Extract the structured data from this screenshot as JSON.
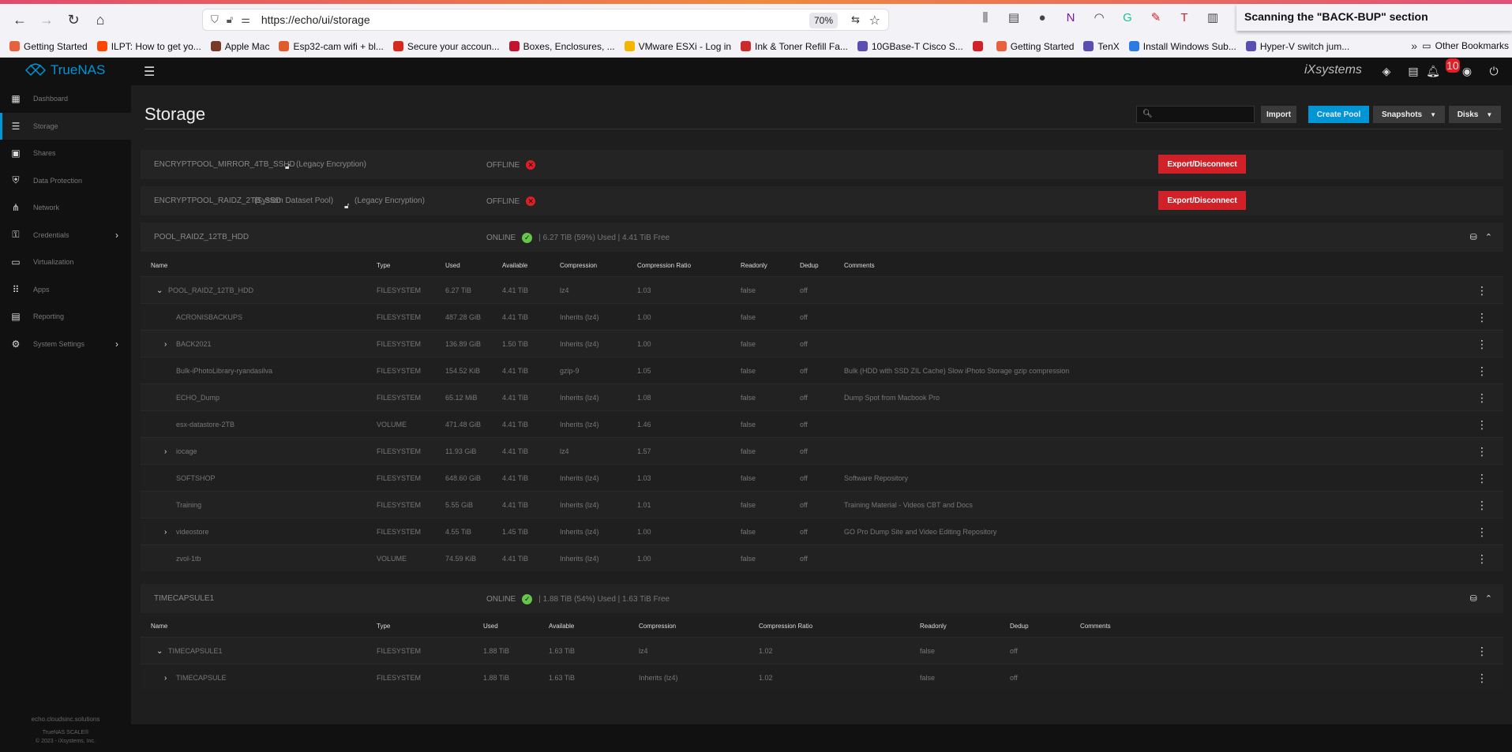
{
  "browser": {
    "url": "https://echo/ui/storage",
    "zoom": "70%",
    "notification": "Scanning the \"BACK-BUP\" section",
    "bookmarks": [
      {
        "label": "Getting Started",
        "color": "#e8603c"
      },
      {
        "label": "ILPT: How to get yo...",
        "color": "#ff4500"
      },
      {
        "label": "Apple Mac",
        "color": "#7a3a2a"
      },
      {
        "label": "Esp32-cam wifi + bl...",
        "color": "#e05a2a"
      },
      {
        "label": "Secure your accoun...",
        "color": "#d52b1e"
      },
      {
        "label": "Boxes, Enclosures, ...",
        "color": "#c41230"
      },
      {
        "label": "VMware ESXi - Log in",
        "color": "#f5b400"
      },
      {
        "label": "Ink & Toner Refill Fa...",
        "color": "#cc2b2b"
      },
      {
        "label": "10GBase-T Cisco S...",
        "color": "#5a4fb0"
      },
      {
        "label": "",
        "color": "#d12027"
      },
      {
        "label": "Getting Started",
        "color": "#e8603c"
      },
      {
        "label": "TenX",
        "color": "#5a4fb0"
      },
      {
        "label": "Install Windows Sub...",
        "color": "#2a7be4"
      },
      {
        "label": "Hyper-V switch jum...",
        "color": "#5a4fb0"
      }
    ],
    "other_bookmarks": "Other Bookmarks"
  },
  "app": {
    "brand": "TrueNAS",
    "vendor": "iXsystems",
    "notification_count": "10",
    "sidebar": {
      "items": [
        {
          "label": "Dashboard",
          "icon": "dashboard-icon",
          "glyph": "▦"
        },
        {
          "label": "Storage",
          "icon": "storage-icon",
          "glyph": "☰"
        },
        {
          "label": "Shares",
          "icon": "shares-icon",
          "glyph": "▣"
        },
        {
          "label": "Data Protection",
          "icon": "shield-icon",
          "glyph": "⛨"
        },
        {
          "label": "Network",
          "icon": "network-icon",
          "glyph": "⋔"
        },
        {
          "label": "Credentials",
          "icon": "key-icon",
          "glyph": "⚿"
        },
        {
          "label": "Virtualization",
          "icon": "monitor-icon",
          "glyph": "▭"
        },
        {
          "label": "Apps",
          "icon": "apps-icon",
          "glyph": "⠿"
        },
        {
          "label": "Reporting",
          "icon": "reporting-icon",
          "glyph": "▤"
        },
        {
          "label": "System Settings",
          "icon": "gear-icon",
          "glyph": "⚙"
        }
      ],
      "host": "echo.cloudsinc.solutions",
      "version": "TrueNAS SCALE®",
      "copyright": "© 2023 - iXsystems, Inc."
    },
    "page_title": "Storage",
    "buttons": {
      "import": "Import",
      "create_pool": "Create Pool",
      "snapshots": "Snapshots",
      "disks": "Disks",
      "export": "Export/Disconnect"
    },
    "pools": {
      "enc1": {
        "name": "ENCRYPTPOOL_MIRROR_4TB_SSHD",
        "extra": "(Legacy Encryption)",
        "status": "OFFLINE"
      },
      "enc2": {
        "name": "ENCRYPTPOOL_RAIDZ_2TB_SSD",
        "extra": "(System Dataset Pool)",
        "extra2": "(Legacy Encryption)",
        "status": "OFFLINE"
      },
      "raidz": {
        "name": "POOL_RAIDZ_12TB_HDD",
        "status": "ONLINE",
        "used": "6.27 TiB (59%) Used",
        "free": "4.41 TiB Free"
      },
      "tc": {
        "name": "TIMECAPSULE1",
        "status": "ONLINE",
        "used": "1.88 TiB (54%) Used",
        "free": "1.63 TiB Free"
      }
    },
    "columns": [
      "Name",
      "Type",
      "Used",
      "Available",
      "Compression",
      "Compression Ratio",
      "Readonly",
      "Dedup",
      "Comments"
    ],
    "raidz_rows": [
      {
        "name": "POOL_RAIDZ_12TB_HDD",
        "type": "FILESYSTEM",
        "used": "6.27 TiB",
        "avail": "4.41 TiB",
        "comp": "lz4",
        "ratio": "1.03",
        "ro": "false",
        "dedup": "off",
        "comment": "",
        "expander": "down",
        "indent": 1
      },
      {
        "name": "ACRONISBACKUPS",
        "type": "FILESYSTEM",
        "used": "487.28 GiB",
        "avail": "4.41 TiB",
        "comp": "Inherits (lz4)",
        "ratio": "1.00",
        "ro": "false",
        "dedup": "off",
        "comment": "",
        "expander": "",
        "indent": 2
      },
      {
        "name": "BACK2021",
        "type": "FILESYSTEM",
        "used": "136.89 GiB",
        "avail": "1.50 TiB",
        "comp": "Inherits (lz4)",
        "ratio": "1.00",
        "ro": "false",
        "dedup": "off",
        "comment": "",
        "expander": "right",
        "indent": 2
      },
      {
        "name": "Bulk-iPhotoLibrary-ryandasilva",
        "type": "FILESYSTEM",
        "used": "154.52 KiB",
        "avail": "4.41 TiB",
        "comp": "gzip-9",
        "ratio": "1.05",
        "ro": "false",
        "dedup": "off",
        "comment": "Bulk (HDD with SSD ZIL Cache) Slow iPhoto Storage gzip compression",
        "expander": "",
        "indent": 2
      },
      {
        "name": "ECHO_Dump",
        "type": "FILESYSTEM",
        "used": "65.12 MiB",
        "avail": "4.41 TiB",
        "comp": "Inherits (lz4)",
        "ratio": "1.08",
        "ro": "false",
        "dedup": "off",
        "comment": "Dump Spot from Macbook Pro",
        "expander": "",
        "indent": 2
      },
      {
        "name": "esx-datastore-2TB",
        "type": "VOLUME",
        "used": "471.48 GiB",
        "avail": "4.41 TiB",
        "comp": "Inherits (lz4)",
        "ratio": "1.46",
        "ro": "false",
        "dedup": "off",
        "comment": "",
        "expander": "",
        "indent": 2
      },
      {
        "name": "iocage",
        "type": "FILESYSTEM",
        "used": "11.93 GiB",
        "avail": "4.41 TiB",
        "comp": "lz4",
        "ratio": "1.57",
        "ro": "false",
        "dedup": "off",
        "comment": "",
        "expander": "right",
        "indent": 2
      },
      {
        "name": "SOFTSHOP",
        "type": "FILESYSTEM",
        "used": "648.60 GiB",
        "avail": "4.41 TiB",
        "comp": "Inherits (lz4)",
        "ratio": "1.03",
        "ro": "false",
        "dedup": "off",
        "comment": "Software Repository",
        "expander": "",
        "indent": 2
      },
      {
        "name": "Training",
        "type": "FILESYSTEM",
        "used": "5.55 GiB",
        "avail": "4.41 TiB",
        "comp": "Inherits (lz4)",
        "ratio": "1.01",
        "ro": "false",
        "dedup": "off",
        "comment": "Training Material - Videos CBT and Docs",
        "expander": "",
        "indent": 2
      },
      {
        "name": "videostore",
        "type": "FILESYSTEM",
        "used": "4.55 TiB",
        "avail": "1.45 TiB",
        "comp": "Inherits (lz4)",
        "ratio": "1.00",
        "ro": "false",
        "dedup": "off",
        "comment": "GO Pro Dump Site and Video Editing Repository",
        "expander": "right",
        "indent": 2
      },
      {
        "name": "zvol-1tb",
        "type": "VOLUME",
        "used": "74.59 KiB",
        "avail": "4.41 TiB",
        "comp": "Inherits (lz4)",
        "ratio": "1.00",
        "ro": "false",
        "dedup": "off",
        "comment": "",
        "expander": "",
        "indent": 2
      }
    ],
    "tc_rows": [
      {
        "name": "TIMECAPSULE1",
        "type": "FILESYSTEM",
        "used": "1.88 TiB",
        "avail": "1.63 TiB",
        "comp": "lz4",
        "ratio": "1.02",
        "ro": "false",
        "dedup": "off",
        "comment": "",
        "expander": "down",
        "indent": 1
      },
      {
        "name": "TIMECAPSULE",
        "type": "FILESYSTEM",
        "used": "1.88 TiB",
        "avail": "1.63 TiB",
        "comp": "Inherits (lz4)",
        "ratio": "1.02",
        "ro": "false",
        "dedup": "off",
        "comment": "",
        "expander": "right",
        "indent": 2
      }
    ]
  }
}
